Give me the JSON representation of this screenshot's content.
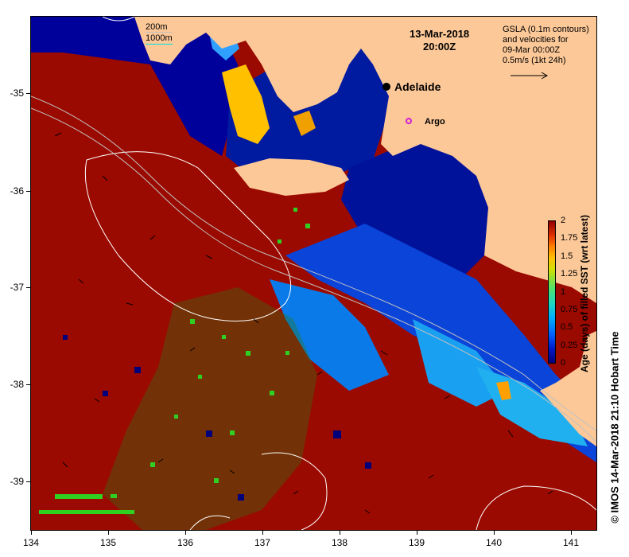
{
  "map": {
    "date_title": "13-Mar-2018",
    "time_title": "20:00Z",
    "gsla_info": [
      "GSLA (0.1m contours)",
      "and velocities for",
      "09-Mar 00:00Z",
      "0.5m/s (1kt 24h)"
    ],
    "depth_legend": [
      "200m",
      "1000m"
    ],
    "city_label": "Adelaide",
    "argo_label": "Argo",
    "credit": "© IMOS 14-Mar-2018 21:10 Hobart Time",
    "x_ticks": [
      "134",
      "135",
      "136",
      "137",
      "138",
      "139",
      "140",
      "141"
    ],
    "y_ticks": [
      "-35",
      "-36",
      "-37",
      "-38",
      "-39"
    ],
    "lon_range": [
      134,
      141.3
    ],
    "lat_range": [
      -39.5,
      -34.2
    ],
    "land_color": "#fcc898",
    "colorbar": {
      "title": "Age (days) of filled SST (wrt latest)",
      "labels": [
        "2",
        "1.75",
        "1.5",
        "1.25",
        "1",
        "0.75",
        "0.5",
        "0.25",
        "0"
      ],
      "colors": [
        "#00007a",
        "#0060ff",
        "#00b0ff",
        "#40e080",
        "#d0e000",
        "#ffc000",
        "#e03000",
        "#900000"
      ]
    }
  }
}
